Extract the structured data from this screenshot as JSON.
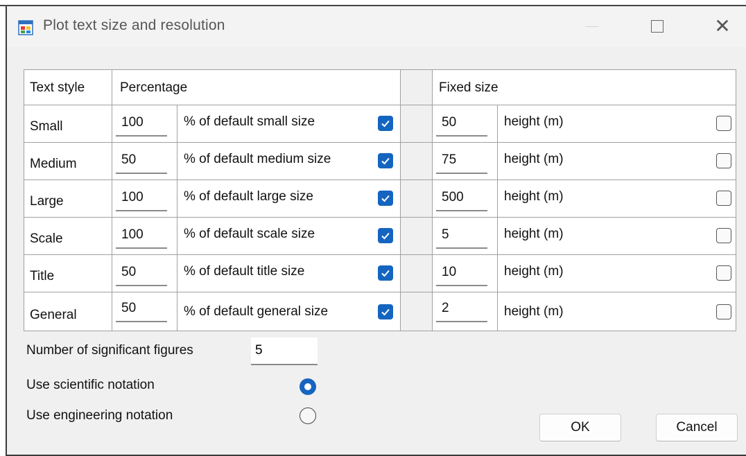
{
  "window": {
    "title": "Plot text size and resolution"
  },
  "table": {
    "headers": {
      "text_style": "Text style",
      "percentage": "Percentage",
      "fixed_size": "Fixed size"
    },
    "rows": [
      {
        "style": "Small",
        "pct_value": "100",
        "pct_desc": "% of default small size",
        "pct_checked": true,
        "fixed_value": "50",
        "fixed_unit": "height (m)",
        "fixed_checked": false
      },
      {
        "style": "Medium",
        "pct_value": "50",
        "pct_desc": "% of default medium size",
        "pct_checked": true,
        "fixed_value": "75",
        "fixed_unit": "height (m)",
        "fixed_checked": false
      },
      {
        "style": "Large",
        "pct_value": "100",
        "pct_desc": "% of default large size",
        "pct_checked": true,
        "fixed_value": "500",
        "fixed_unit": "height (m)",
        "fixed_checked": false
      },
      {
        "style": "Scale",
        "pct_value": "100",
        "pct_desc": "% of default scale size",
        "pct_checked": true,
        "fixed_value": "5",
        "fixed_unit": "height (m)",
        "fixed_checked": false
      },
      {
        "style": "Title",
        "pct_value": "50",
        "pct_desc": "% of default title size",
        "pct_checked": true,
        "fixed_value": "10",
        "fixed_unit": "height (m)",
        "fixed_checked": false
      },
      {
        "style": "General",
        "pct_value": "50",
        "pct_desc": "% of default general size",
        "pct_checked": true,
        "fixed_value": "2",
        "fixed_unit": "height (m)",
        "fixed_checked": false
      }
    ]
  },
  "options": {
    "sig_figs_label": "Number of significant figures",
    "sig_figs_value": "5",
    "scientific_label": "Use scientific notation",
    "scientific_selected": true,
    "engineering_label": "Use engineering notation",
    "engineering_selected": false
  },
  "buttons": {
    "ok": "OK",
    "cancel": "Cancel"
  },
  "colors": {
    "accent": "#1565c0",
    "grid_line": "#a0a0a0",
    "dialog_bg": "#f0f0f0"
  },
  "icons": {
    "app": "app-window-icon",
    "minimize": "minimize-icon",
    "maximize": "maximize-icon",
    "close": "close-icon",
    "check": "checkmark-icon"
  }
}
